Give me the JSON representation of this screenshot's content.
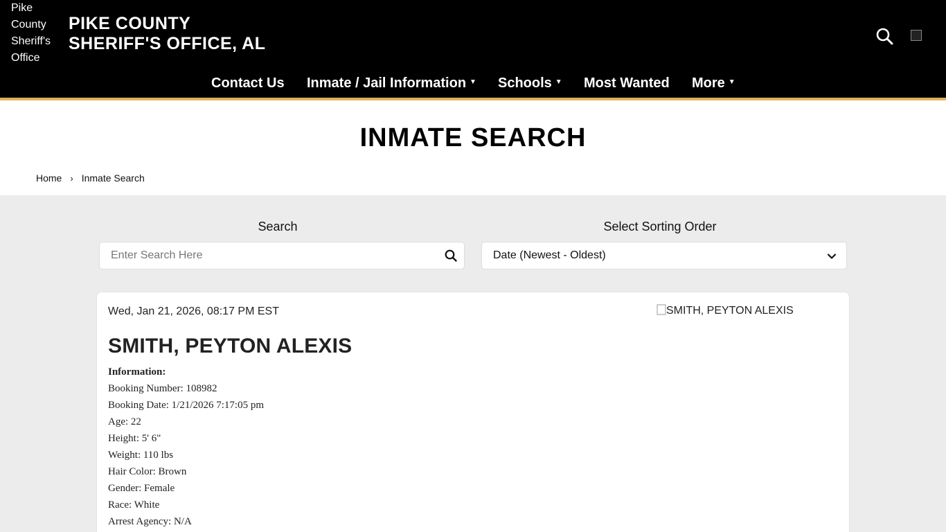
{
  "header": {
    "logo_alt": "Pike County Sheriff's Office",
    "title_line1": "PIKE COUNTY",
    "title_line2": "SHERIFF'S OFFICE, AL",
    "accent_color": "#e0b25a"
  },
  "nav": {
    "items": [
      {
        "label": "Contact Us",
        "has_caret": false
      },
      {
        "label": "Inmate / Jail Information",
        "has_caret": true
      },
      {
        "label": "Schools",
        "has_caret": true
      },
      {
        "label": "Most Wanted",
        "has_caret": false
      },
      {
        "label": "More",
        "has_caret": true
      }
    ],
    "caret": "▼"
  },
  "page": {
    "title": "INMATE SEARCH",
    "breadcrumb": {
      "home": "Home",
      "separator": "›",
      "current": "Inmate Search"
    }
  },
  "search": {
    "label": "Search",
    "placeholder": "Enter Search Here",
    "value": ""
  },
  "sort": {
    "label": "Select Sorting Order",
    "selected": "Date (Newest - Oldest)"
  },
  "inmate": {
    "date": "Wed, Jan 21, 2026, 08:17 PM EST",
    "photo_alt": "SMITH, PEYTON ALEXIS",
    "name": "SMITH, PEYTON ALEXIS",
    "info_heading": "Information:",
    "fields": [
      "Booking Number: 108982",
      "Booking Date: 1/21/2026 7:17:05 pm",
      "Age: 22",
      "Height: 5' 6\"",
      "Weight: 110 lbs",
      "Hair Color: Brown",
      "Gender: Female",
      "Race: White",
      "Arrest Agency: N/A"
    ]
  }
}
